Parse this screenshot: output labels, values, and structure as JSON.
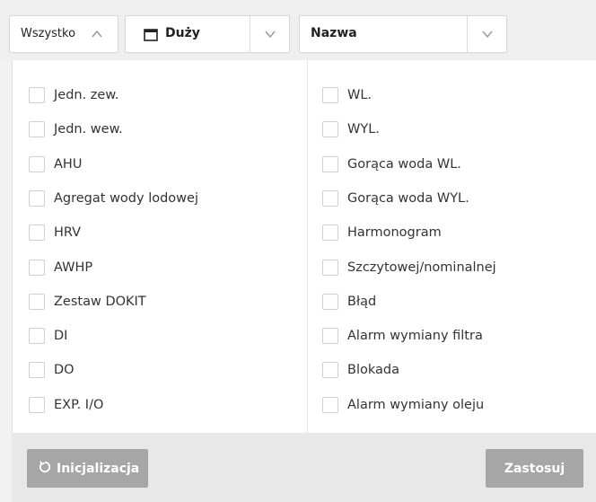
{
  "toolbar": {
    "filter": {
      "value": "Wszystko",
      "icon": "chevron-up-icon"
    },
    "size": {
      "value": "Duży",
      "icon": "window-icon",
      "chevron": "chevron-down-icon"
    },
    "sort": {
      "value": "Nazwa",
      "chevron": "chevron-down-icon"
    }
  },
  "filters": {
    "left": [
      "Jedn. zew.",
      "Jedn. wew.",
      "AHU",
      "Agregat wody lodowej",
      "HRV",
      "AWHP",
      "Zestaw DOKIT",
      "DI",
      "DO",
      "EXP. I/O"
    ],
    "right": [
      "WL.",
      "WYL.",
      "Gorąca woda WL.",
      "Gorąca woda WYL.",
      "Harmonogram",
      "Szczytowej/nominalnej",
      "Błąd",
      "Alarm wymiany filtra",
      "Blokada",
      "Alarm wymiany oleju"
    ]
  },
  "footer": {
    "reset_label": "Inicjalizacja",
    "reset_icon": "refresh-icon",
    "apply_label": "Zastosuj"
  }
}
